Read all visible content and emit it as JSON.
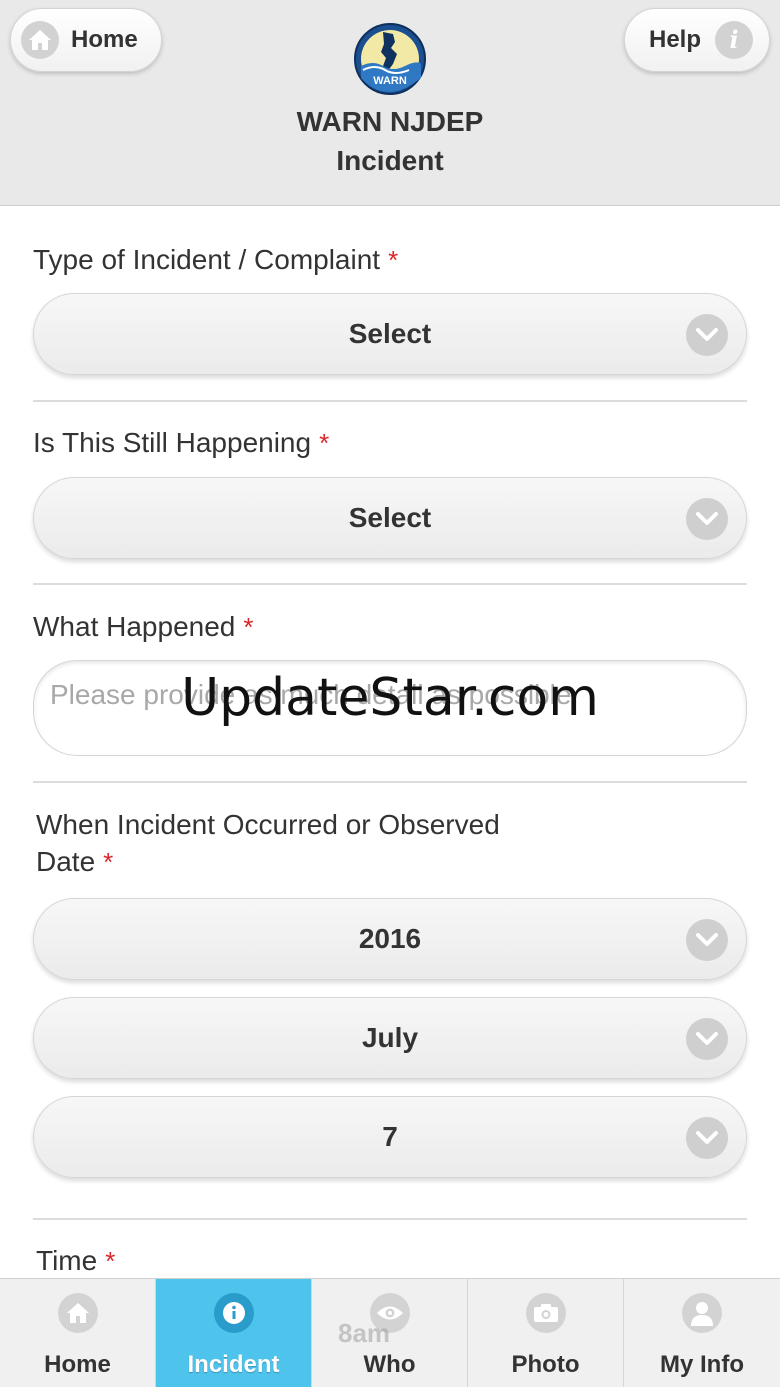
{
  "header": {
    "home_label": "Home",
    "help_label": "Help",
    "logo_text": "WARN",
    "title_line1": "WARN NJDEP",
    "title_line2": "Incident"
  },
  "form": {
    "type_label": "Type of Incident / Complaint",
    "type_value": "Select",
    "still_label": "Is This Still Happening",
    "still_value": "Select",
    "what_label": "What Happened",
    "what_placeholder": "Please provide as much detail as possible",
    "when_label_line1": "When Incident Occurred or Observed",
    "date_label": "Date",
    "year_value": "2016",
    "month_value": "July",
    "day_value": "7",
    "time_label": "Time",
    "time_value": "8am",
    "required_mark": "*"
  },
  "watermark": "UpdateStar.com",
  "bottom_nav": {
    "items": [
      {
        "label": "Home",
        "icon": "home-icon"
      },
      {
        "label": "Incident",
        "icon": "info-icon",
        "active": true
      },
      {
        "label": "Who",
        "icon": "eye-icon"
      },
      {
        "label": "Photo",
        "icon": "camera-icon"
      },
      {
        "label": "My Info",
        "icon": "person-icon"
      }
    ]
  },
  "colors": {
    "accent": "#4ec3ec",
    "required": "#d9262b",
    "header_bg": "#e9e9e9"
  }
}
